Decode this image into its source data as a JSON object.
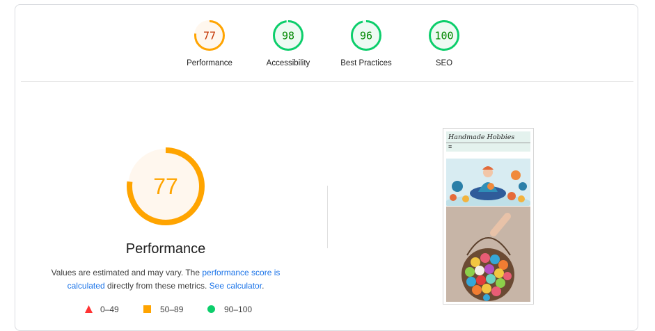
{
  "colors": {
    "average": "#ffa400",
    "average_text": "#c33300",
    "pass": "#0cce6b",
    "pass_text": "#008800",
    "fail": "#ff3333",
    "link": "#1a73e8"
  },
  "summary_gauges": [
    {
      "score": 77,
      "label": "Performance",
      "rating": "average"
    },
    {
      "score": 98,
      "label": "Accessibility",
      "rating": "pass"
    },
    {
      "score": 96,
      "label": "Best Practices",
      "rating": "pass"
    },
    {
      "score": 100,
      "label": "SEO",
      "rating": "pass"
    }
  ],
  "main": {
    "score": 77,
    "title": "Performance",
    "desc_prefix": "Values are estimated and may vary. The ",
    "desc_link": "performance score is calculated",
    "desc_middle": " directly from these metrics. ",
    "desc_link2": "See calculator",
    "desc_suffix": "."
  },
  "legend": [
    {
      "shape": "triangle",
      "range": "0–49"
    },
    {
      "shape": "square",
      "range": "50–89"
    },
    {
      "shape": "circle",
      "range": "90–100"
    }
  ],
  "screenshot": {
    "site_title": "Handmade Hobbies",
    "menu_icon": "hamburger-icon"
  }
}
